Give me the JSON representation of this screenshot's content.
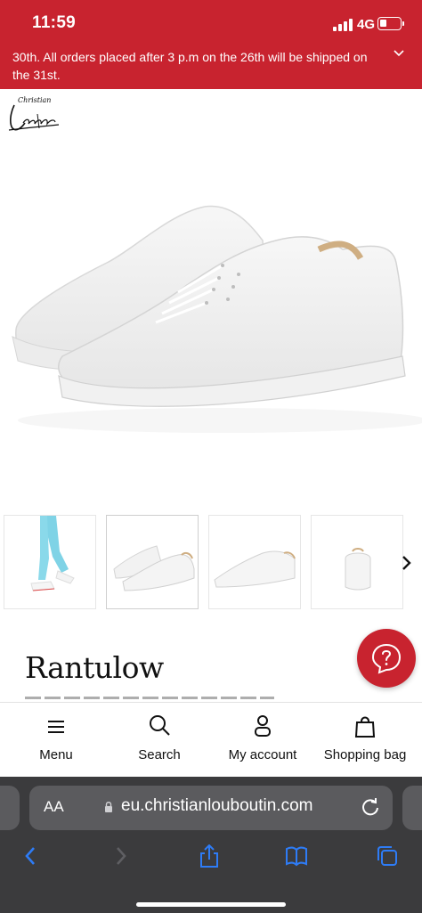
{
  "status_bar": {
    "time": "11:59",
    "network": "4G"
  },
  "banner": {
    "text": "30th. All orders placed after 3 p.m on the 26th will be shipped on the 31st."
  },
  "brand": {
    "logo_small": "Christian",
    "logo_script": "Louboutin"
  },
  "product": {
    "title": "Rantulow"
  },
  "thumbnails": [
    "thumb-1",
    "thumb-2",
    "thumb-3",
    "thumb-4"
  ],
  "tabbar": {
    "menu": "Menu",
    "search": "Search",
    "account": "My account",
    "bag": "Shopping bag"
  },
  "browser": {
    "text_size": "AA",
    "url": "eu.christianlouboutin.com"
  },
  "colors": {
    "brand_red": "#c8232f",
    "safari_bar": "#3b3b3d",
    "safari_blue": "#2e7cf6"
  },
  "icons": [
    "signal-icon",
    "battery-icon",
    "chevron-down-icon",
    "help-icon",
    "menu-icon",
    "search-icon",
    "account-icon",
    "bag-icon",
    "lock-icon",
    "reload-icon",
    "back-icon",
    "forward-icon",
    "share-icon",
    "bookmarks-icon",
    "tabs-icon",
    "chevron-right-icon"
  ]
}
